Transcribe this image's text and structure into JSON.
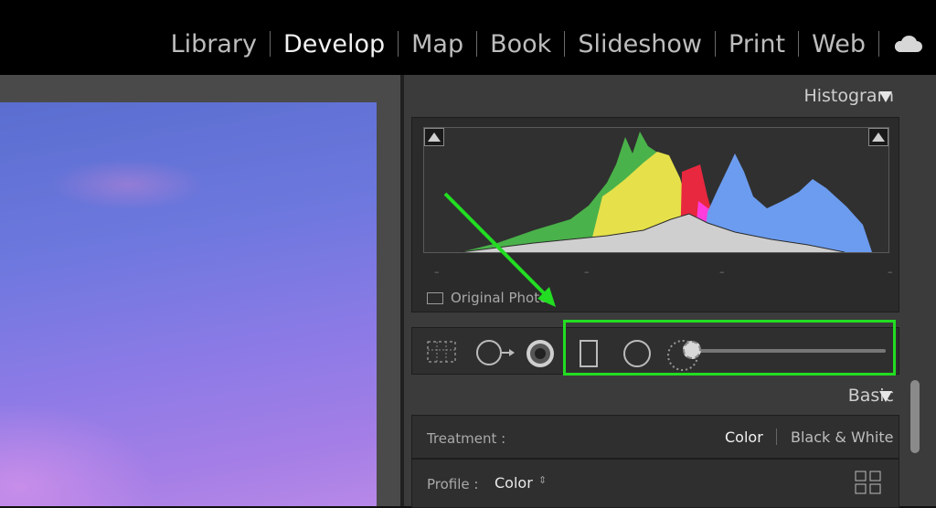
{
  "modules": [
    "Library",
    "Develop",
    "Map",
    "Book",
    "Slideshow",
    "Print",
    "Web"
  ],
  "active_module": "Develop",
  "histogram": {
    "title": "Histogram",
    "original_photo_label": "Original Photo"
  },
  "basic": {
    "title": "Basic",
    "treatment_label": "Treatment :",
    "treatment_options": [
      "Color",
      "Black & White"
    ],
    "profile_label": "Profile :",
    "profile_value": "Color"
  },
  "tools": [
    "crop-overlay",
    "spot-removal",
    "red-eye",
    "graduated-filter",
    "radial-filter",
    "adjustment-brush"
  ],
  "colors": {
    "highlight": "#22dd22",
    "arrow": "#22dd22"
  },
  "icons": [
    "cloud-icon",
    "collapse-triangle-icon",
    "clip-warning-icon",
    "grid-view-icon"
  ]
}
